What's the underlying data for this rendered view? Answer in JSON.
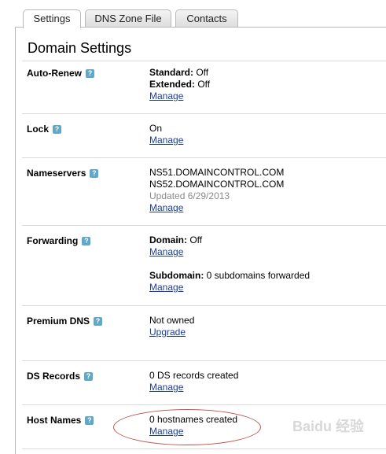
{
  "tabs": [
    "Settings",
    "DNS Zone File",
    "Contacts"
  ],
  "title": "Domain Settings",
  "rows": {
    "autorenew": {
      "label": "Auto-Renew",
      "standard_key": "Standard:",
      "standard_val": " Off",
      "extended_key": "Extended:",
      "extended_val": " Off",
      "link": "Manage"
    },
    "lock": {
      "label": "Lock",
      "status": "On",
      "link": "Manage"
    },
    "nameservers": {
      "label": "Nameservers",
      "ns1": "NS51.DOMAINCONTROL.COM",
      "ns2": "NS52.DOMAINCONTROL.COM",
      "updated": "Updated 6/29/2013",
      "link": "Manage"
    },
    "forwarding": {
      "label": "Forwarding",
      "domain_key": "Domain:",
      "domain_val": " Off",
      "link1": "Manage",
      "sub_key": "Subdomain:",
      "sub_val": " 0 subdomains forwarded",
      "link2": "Manage"
    },
    "premium": {
      "label": "Premium DNS",
      "status": "Not owned",
      "link": "Upgrade"
    },
    "ds": {
      "label": "DS Records",
      "status": "0 DS records created",
      "link": "Manage"
    },
    "hosts": {
      "label": "Host Names",
      "status": "0 hostnames created",
      "link": "Manage"
    }
  },
  "help_glyph": "?",
  "watermark": "Baidu 经验",
  "accent_colors": {
    "link": "#1a3c9c",
    "help_icon": "#5fa8c9",
    "annotation": "#c0504d"
  }
}
